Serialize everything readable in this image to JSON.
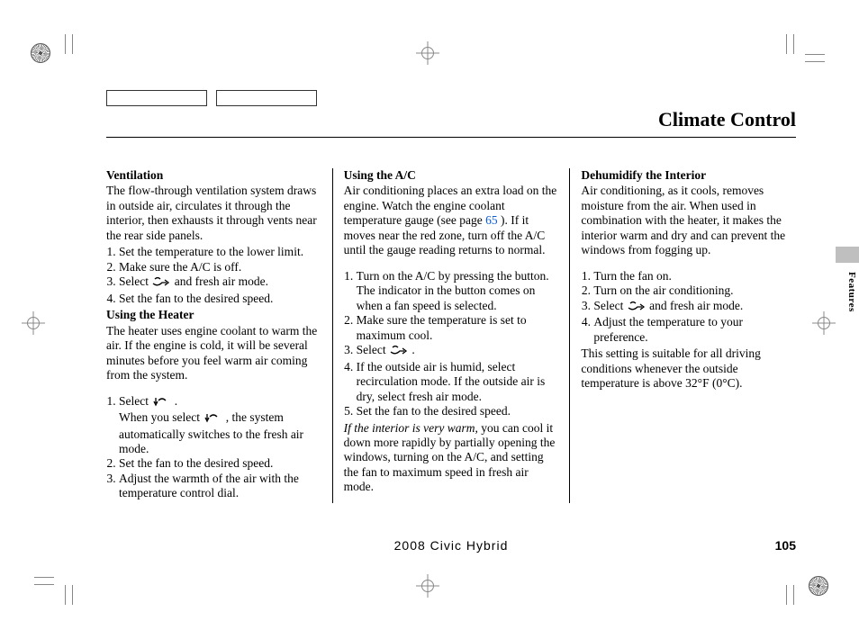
{
  "header": {
    "title": "Climate Control"
  },
  "side_tab": "Features",
  "footer": {
    "center": "2008  Civic  Hybrid",
    "page_no": "105"
  },
  "link_page": "65",
  "col1": {
    "ventilation_title": "Ventilation",
    "ventilation_para": "The flow-through ventilation system draws in outside air, circulates it through the interior, then exhausts it through vents near the rear side panels.",
    "ventilation_steps": {
      "s1": "Set the temperature to the lower limit.",
      "s2": "Make sure the A/C is off.",
      "s3_a": "Select",
      "s3_icon": "vent-bilevel-icon",
      "s3_b": "and fresh air mode.",
      "s4": "Set the fan to the desired speed."
    },
    "heater_title": "Using the Heater",
    "heater_para": "The heater uses engine coolant to warm the air. If the engine is cold, it will be several minutes before you feel warm air coming from the system.",
    "heater_steps": {
      "s1_a": "Select",
      "s1_b": ".",
      "s1_c1": "When you select",
      "s1_c2": ", the system automatically switches to the fresh air mode.",
      "s2": "Set the fan to the desired speed.",
      "s3": "Adjust the warmth of the air with the temperature control dial."
    }
  },
  "col2": {
    "ac_title": "Using the A/C",
    "ac_para_a": "Air conditioning places an extra load on the engine. Watch the engine coolant temperature gauge (see page",
    "ac_para_b": "). If it moves near the red zone, turn off the A/C until the gauge reading returns to normal.",
    "ac_steps": {
      "s1": "Turn on the A/C by pressing the button. The indicator in the button comes on when a fan speed is selected.",
      "s2": "Make sure the temperature is set to maximum cool.",
      "s3_a": "Select",
      "s3_b": ".",
      "s4": "If the outside air is humid, select recirculation mode. If the outside air is dry, select fresh air mode.",
      "s5": "Set the fan to the desired speed."
    },
    "tip_ital": "If the interior is very warm,",
    "tip_rest": " you can cool it down more rapidly by partially opening the windows, turning on the A/C, and setting the fan to maximum speed in fresh air mode."
  },
  "col3": {
    "dh_title": "Dehumidify the Interior",
    "dh_para": "Air conditioning, as it cools, removes moisture from the air. When used in combination with the heater, it makes the interior warm and dry and can prevent the windows from fogging up.",
    "dh_steps": {
      "s1": "Turn the fan on.",
      "s2": "Turn on the air conditioning.",
      "s3_a": "Select",
      "s3_b": "and fresh air mode.",
      "s4": "Adjust the temperature to your preference."
    },
    "dh_tail": "This setting is suitable for all driving conditions whenever the outside temperature is above 32°F (0°C)."
  }
}
